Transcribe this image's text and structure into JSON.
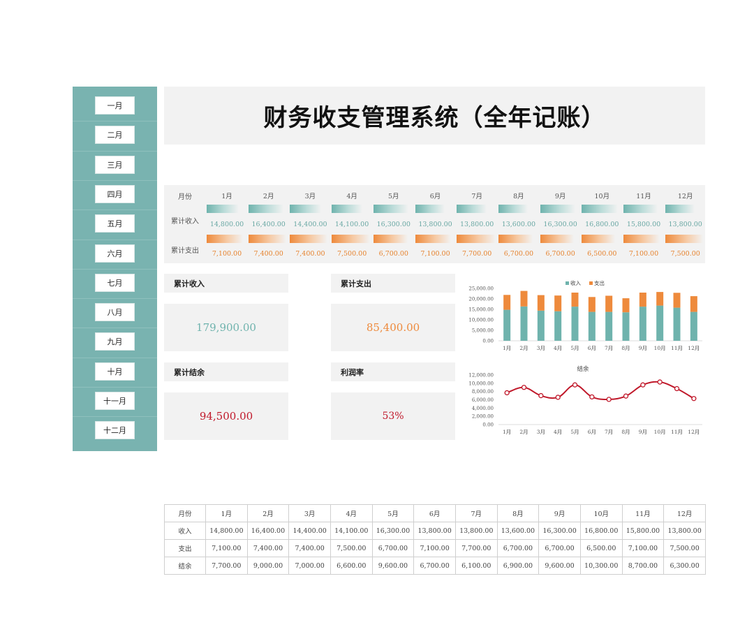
{
  "title": "财务收支管理系统（全年记账）",
  "sidebar": {
    "months": [
      "一月",
      "二月",
      "三月",
      "四月",
      "五月",
      "六月",
      "七月",
      "八月",
      "九月",
      "十月",
      "十一月",
      "十二月"
    ]
  },
  "strip": {
    "month_label": "月份",
    "income_label": "累计收入",
    "expense_label": "累计支出",
    "months": [
      "1月",
      "2月",
      "3月",
      "4月",
      "5月",
      "6月",
      "7月",
      "8月",
      "9月",
      "10月",
      "11月",
      "12月"
    ],
    "income": [
      "14,800.00",
      "16,400.00",
      "14,400.00",
      "14,100.00",
      "16,300.00",
      "13,800.00",
      "13,800.00",
      "13,600.00",
      "16,300.00",
      "16,800.00",
      "15,800.00",
      "13,800.00"
    ],
    "expense": [
      "7,100.00",
      "7,400.00",
      "7,400.00",
      "7,500.00",
      "6,700.00",
      "7,100.00",
      "7,700.00",
      "6,700.00",
      "6,700.00",
      "6,500.00",
      "7,100.00",
      "7,500.00"
    ]
  },
  "kpi": {
    "income_label": "累计收入",
    "income_value": "179,900.00",
    "expense_label": "累计支出",
    "expense_value": "85,400.00",
    "balance_label": "累计结余",
    "balance_value": "94,500.00",
    "profit_label": "利润率",
    "profit_value": "53%"
  },
  "colors": {
    "teal": "#79b3b0",
    "income": "#6fb3ad",
    "expense": "#ee8a3c",
    "balance_value": "#c0182a",
    "line": "#c0182a"
  },
  "chart_data": [
    {
      "type": "bar",
      "stacked": true,
      "categories": [
        "1月",
        "2月",
        "3月",
        "4月",
        "5月",
        "6月",
        "7月",
        "8月",
        "9月",
        "10月",
        "11月",
        "12月"
      ],
      "series": [
        {
          "name": "收入",
          "values": [
            14800,
            16400,
            14400,
            14100,
            16300,
            13800,
            13800,
            13600,
            16300,
            16800,
            15800,
            13800
          ]
        },
        {
          "name": "支出",
          "values": [
            7100,
            7400,
            7400,
            7500,
            6700,
            7100,
            7700,
            6700,
            6700,
            6500,
            7100,
            7500
          ]
        }
      ],
      "yticks": [
        "0.00",
        "5,000.00",
        "10,000.00",
        "15,000.00",
        "20,000.00",
        "25,000.00"
      ],
      "ylim": [
        0,
        25000
      ],
      "legend": "top-right"
    },
    {
      "type": "line",
      "title": "结余",
      "categories": [
        "1月",
        "2月",
        "3月",
        "4月",
        "5月",
        "6月",
        "7月",
        "8月",
        "9月",
        "10月",
        "11月",
        "12月"
      ],
      "series": [
        {
          "values": [
            7700,
            9000,
            7000,
            6600,
            9600,
            6700,
            6100,
            6900,
            9600,
            10300,
            8700,
            6300
          ]
        }
      ],
      "yticks": [
        "0.00",
        "2,000.00",
        "4,000.00",
        "6,000.00",
        "8,000.00",
        "10,000.00",
        "12,000.00"
      ],
      "ylim": [
        0,
        12000
      ]
    }
  ],
  "table": {
    "header_label": "月份",
    "months": [
      "1月",
      "2月",
      "3月",
      "4月",
      "5月",
      "6月",
      "7月",
      "8月",
      "9月",
      "10月",
      "11月",
      "12月"
    ],
    "rows": [
      {
        "label": "收入",
        "values": [
          "14,800.00",
          "16,400.00",
          "14,400.00",
          "14,100.00",
          "16,300.00",
          "13,800.00",
          "13,800.00",
          "13,600.00",
          "16,300.00",
          "16,800.00",
          "15,800.00",
          "13,800.00"
        ]
      },
      {
        "label": "支出",
        "values": [
          "7,100.00",
          "7,400.00",
          "7,400.00",
          "7,500.00",
          "6,700.00",
          "7,100.00",
          "7,700.00",
          "6,700.00",
          "6,700.00",
          "6,500.00",
          "7,100.00",
          "7,500.00"
        ]
      },
      {
        "label": "结余",
        "values": [
          "7,700.00",
          "9,000.00",
          "7,000.00",
          "6,600.00",
          "9,600.00",
          "6,700.00",
          "6,100.00",
          "6,900.00",
          "9,600.00",
          "10,300.00",
          "8,700.00",
          "6,300.00"
        ]
      }
    ]
  }
}
